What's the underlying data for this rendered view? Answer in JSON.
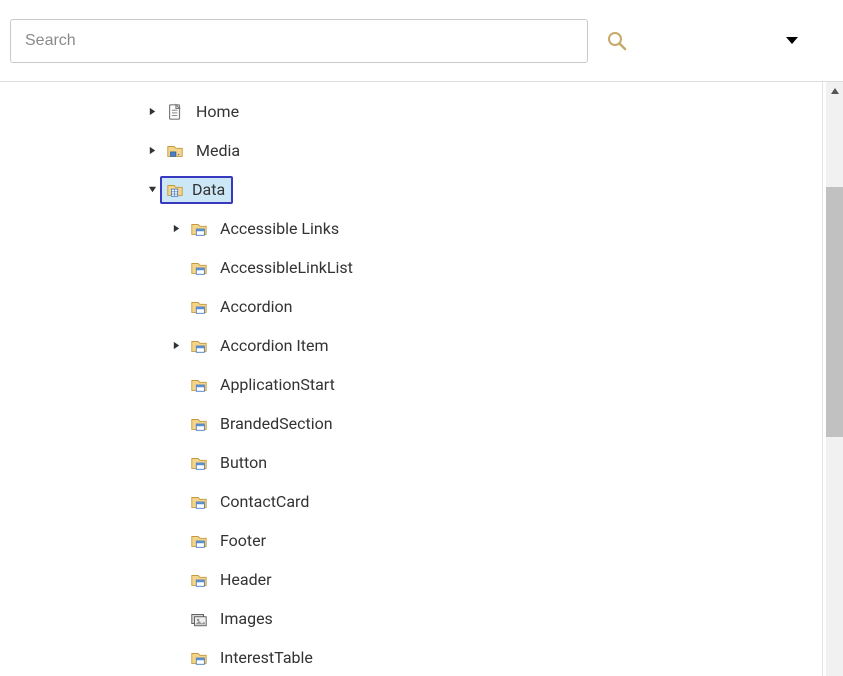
{
  "search": {
    "placeholder": "Search",
    "value": ""
  },
  "tree": {
    "nodes": [
      {
        "id": "home",
        "label": "Home",
        "icon": "file",
        "depth": 0,
        "expander": "collapsed",
        "selected": false
      },
      {
        "id": "media",
        "label": "Media",
        "icon": "media",
        "depth": 0,
        "expander": "collapsed",
        "selected": false
      },
      {
        "id": "data",
        "label": "Data",
        "icon": "data",
        "depth": 0,
        "expander": "expanded",
        "selected": true
      },
      {
        "id": "accessible-links",
        "label": "Accessible Links",
        "icon": "folder",
        "depth": 1,
        "expander": "collapsed",
        "selected": false
      },
      {
        "id": "accessiblelinklist",
        "label": "AccessibleLinkList",
        "icon": "folder",
        "depth": 1,
        "expander": "none",
        "selected": false
      },
      {
        "id": "accordion",
        "label": "Accordion",
        "icon": "folder",
        "depth": 1,
        "expander": "none",
        "selected": false
      },
      {
        "id": "accordion-item",
        "label": "Accordion Item",
        "icon": "folder",
        "depth": 1,
        "expander": "collapsed",
        "selected": false
      },
      {
        "id": "applicationstart",
        "label": "ApplicationStart",
        "icon": "folder",
        "depth": 1,
        "expander": "none",
        "selected": false
      },
      {
        "id": "brandedsection",
        "label": "BrandedSection",
        "icon": "folder",
        "depth": 1,
        "expander": "none",
        "selected": false
      },
      {
        "id": "button",
        "label": "Button",
        "icon": "folder",
        "depth": 1,
        "expander": "none",
        "selected": false
      },
      {
        "id": "contactcard",
        "label": "ContactCard",
        "icon": "folder",
        "depth": 1,
        "expander": "none",
        "selected": false
      },
      {
        "id": "footer",
        "label": "Footer",
        "icon": "folder",
        "depth": 1,
        "expander": "none",
        "selected": false
      },
      {
        "id": "header",
        "label": "Header",
        "icon": "folder",
        "depth": 1,
        "expander": "none",
        "selected": false
      },
      {
        "id": "images",
        "label": "Images",
        "icon": "images",
        "depth": 1,
        "expander": "none",
        "selected": false
      },
      {
        "id": "interesttable",
        "label": "InterestTable",
        "icon": "folder",
        "depth": 1,
        "expander": "none",
        "selected": false
      }
    ]
  },
  "indent": {
    "base": 124,
    "step": 24
  }
}
